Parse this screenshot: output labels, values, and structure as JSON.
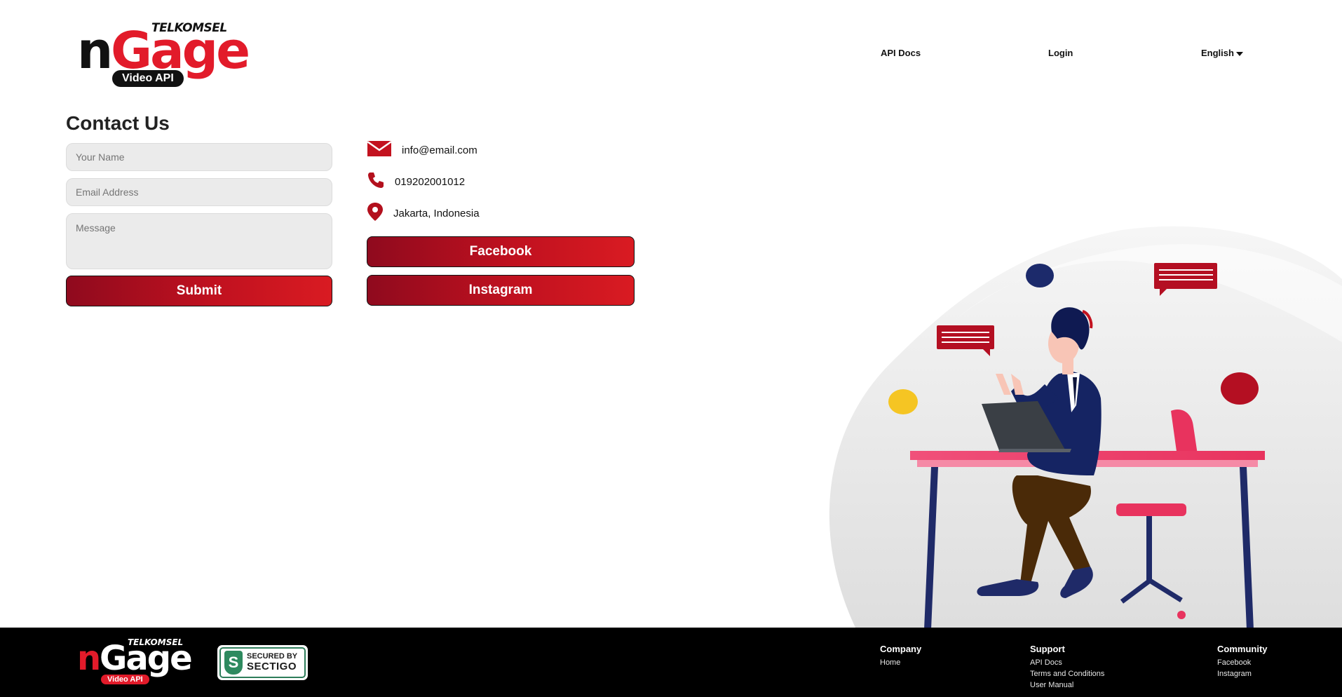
{
  "header": {
    "logo": {
      "top": "TELKOMSEL",
      "n": "n",
      "gage": "Gage",
      "pill": "Video API"
    },
    "nav": {
      "api_docs": "API Docs",
      "login": "Login",
      "language": "English"
    }
  },
  "contact": {
    "title": "Contact Us",
    "form": {
      "name_placeholder": "Your Name",
      "email_placeholder": "Email Address",
      "message_placeholder": "Message",
      "submit_label": "Submit"
    },
    "info": {
      "email": "info@email.com",
      "phone": "019202001012",
      "location": "Jakarta, Indonesia"
    },
    "social": {
      "facebook_label": "Facebook",
      "instagram_label": "Instagram"
    }
  },
  "footer": {
    "logo": {
      "top": "TELKOMSEL",
      "n": "n",
      "gage": "Gage",
      "pill": "Video API"
    },
    "badge": {
      "line1": "SECURED BY",
      "line2": "SECTIGO"
    },
    "columns": {
      "company": {
        "heading": "Company",
        "links": [
          "Home"
        ]
      },
      "support": {
        "heading": "Support",
        "links": [
          "API Docs",
          "Terms and Conditions",
          "User Manual"
        ]
      },
      "community": {
        "heading": "Community",
        "links": [
          "Facebook",
          "Instagram"
        ]
      }
    }
  },
  "colors": {
    "brand_red": "#e21b2a",
    "button_dark": "#8f0a1e",
    "footer_bg": "#000000",
    "field_bg": "#ebebeb"
  },
  "icons": [
    "mail-icon",
    "phone-icon",
    "location-pin-icon",
    "dropdown-caret-icon",
    "sectigo-shield-icon"
  ]
}
